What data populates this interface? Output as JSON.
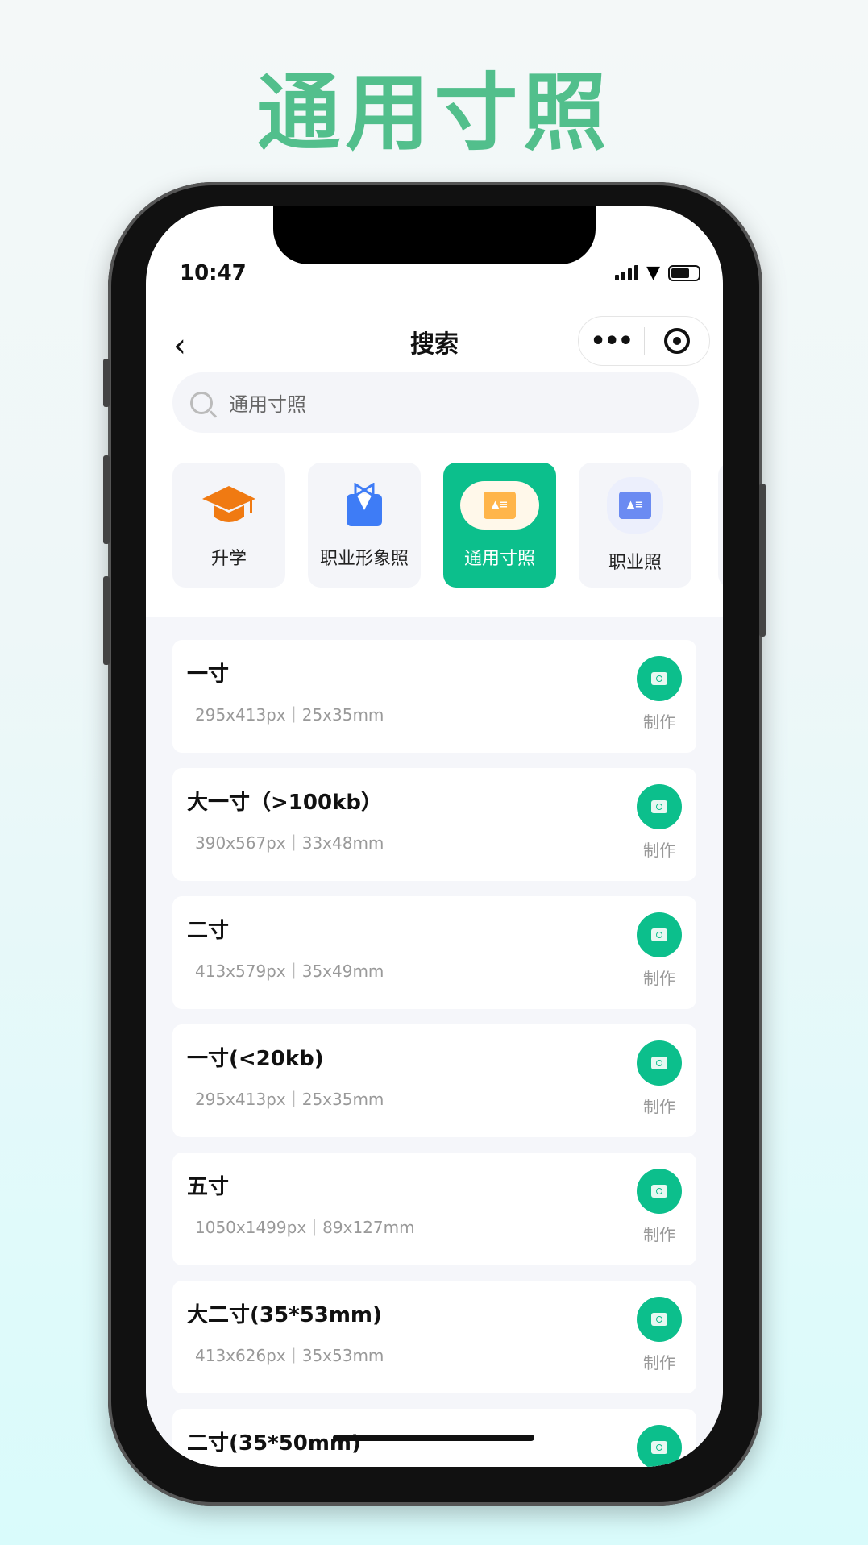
{
  "headline": "通用寸照",
  "status": {
    "time": "10:47"
  },
  "nav": {
    "title": "搜索",
    "back_icon": "chevron-left-icon",
    "more_icon": "more-dots-icon",
    "close_icon": "target-icon"
  },
  "search": {
    "value": "通用寸照"
  },
  "categories": [
    {
      "label": "升学",
      "icon": "graduation-cap-icon",
      "active": false
    },
    {
      "label": "职业形象照",
      "icon": "suit-bowtie-icon",
      "active": false
    },
    {
      "label": "通用寸照",
      "icon": "id-card-icon",
      "active": true
    },
    {
      "label": "职业照",
      "icon": "id-card-icon",
      "active": false
    }
  ],
  "items": [
    {
      "title": "一寸",
      "spec": "295x413px｜25x35mm",
      "action": "制作"
    },
    {
      "title": "大一寸（>100kb）",
      "spec": "390x567px｜33x48mm",
      "action": "制作"
    },
    {
      "title": "二寸",
      "spec": "413x579px｜35x49mm",
      "action": "制作"
    },
    {
      "title": "一寸(<20kb)",
      "spec": "295x413px｜25x35mm",
      "action": "制作"
    },
    {
      "title": "五寸",
      "spec": "1050x1499px｜89x127mm",
      "action": "制作"
    },
    {
      "title": "大二寸(35*53mm)",
      "spec": "413x626px｜35x53mm",
      "action": "制作"
    },
    {
      "title": "二寸(35*50mm)",
      "spec": "",
      "action": ""
    }
  ],
  "colors": {
    "accent": "#0cbf8c",
    "headline": "#52bf8c"
  }
}
